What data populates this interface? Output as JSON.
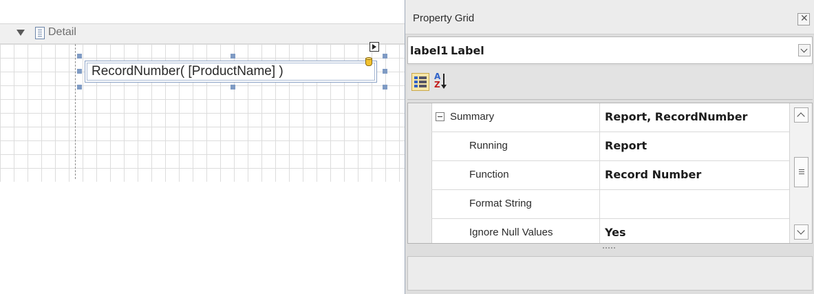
{
  "designer": {
    "band_title": "Detail",
    "label_text": "RecordNumber( [ProductName] )"
  },
  "property_grid": {
    "title": "Property Grid",
    "close_glyph": "✕",
    "selected_name": "label1",
    "selected_type": "Label",
    "rows": [
      {
        "name": "Summary",
        "value": "Report, RecordNumber",
        "expanded": true
      },
      {
        "name": "Running",
        "value": "Report"
      },
      {
        "name": "Function",
        "value": "Record Number"
      },
      {
        "name": "Format String",
        "value": ""
      },
      {
        "name": "Ignore Null Values",
        "value": "Yes"
      }
    ]
  },
  "icons": {
    "band_collapse": "triangle-down-icon",
    "band": "detail-band-icon",
    "smart_tag": "smart-tag-arrow-icon",
    "data_binding": "database-icon",
    "close": "close-icon",
    "dropdown": "chevron-down-icon",
    "categorized": "categorized-view-icon",
    "alphabetical": "sort-alphabetical-icon",
    "collapse": "minus-box-icon"
  },
  "colors": {
    "selection_handle": "#7f9bc4",
    "database_icon": "#f2c230",
    "alpha_a": "#2f62c9",
    "alpha_z": "#c21d1d"
  }
}
